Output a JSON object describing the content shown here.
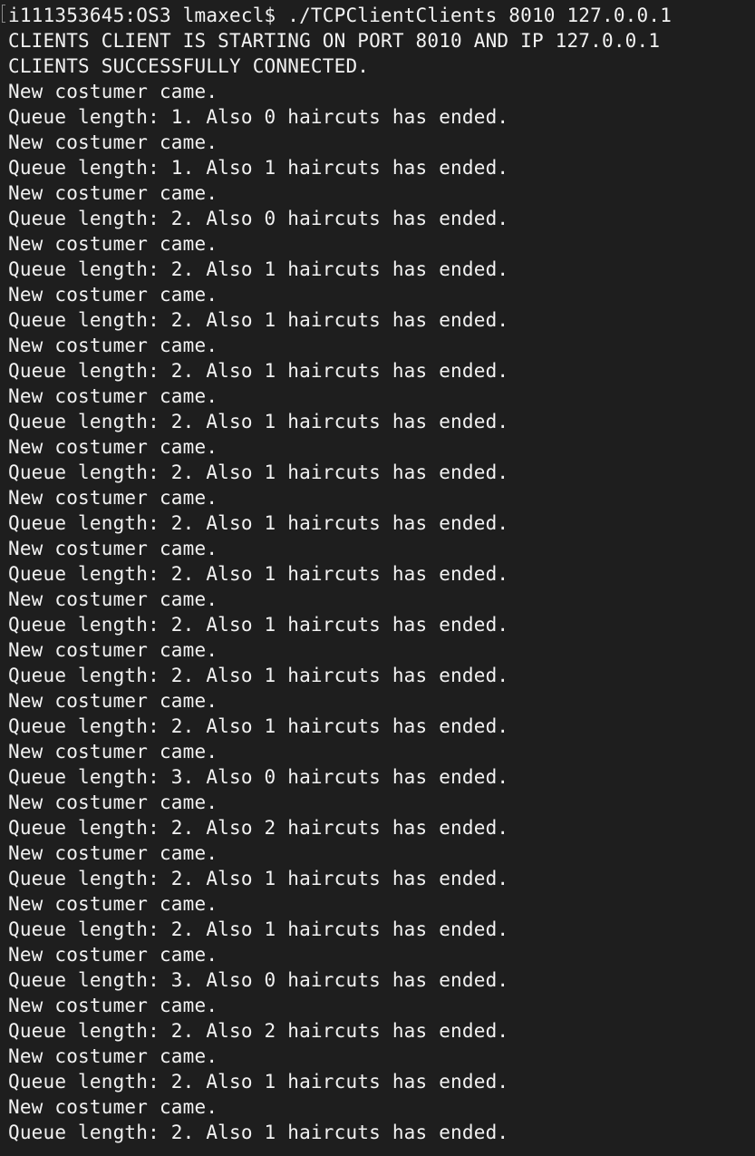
{
  "terminal": {
    "lines": [
      "i111353645:OS3 lmaxecl$ ./TCPClientClients 8010 127.0.0.1",
      "CLIENTS CLIENT IS STARTING ON PORT 8010 AND IP 127.0.0.1",
      "CLIENTS SUCCESSFULLY CONNECTED.",
      "New costumer came.",
      "Queue length: 1. Also 0 haircuts has ended.",
      "New costumer came.",
      "Queue length: 1. Also 1 haircuts has ended.",
      "New costumer came.",
      "Queue length: 2. Also 0 haircuts has ended.",
      "New costumer came.",
      "Queue length: 2. Also 1 haircuts has ended.",
      "New costumer came.",
      "Queue length: 2. Also 1 haircuts has ended.",
      "New costumer came.",
      "Queue length: 2. Also 1 haircuts has ended.",
      "New costumer came.",
      "Queue length: 2. Also 1 haircuts has ended.",
      "New costumer came.",
      "Queue length: 2. Also 1 haircuts has ended.",
      "New costumer came.",
      "Queue length: 2. Also 1 haircuts has ended.",
      "New costumer came.",
      "Queue length: 2. Also 1 haircuts has ended.",
      "New costumer came.",
      "Queue length: 2. Also 1 haircuts has ended.",
      "New costumer came.",
      "Queue length: 2. Also 1 haircuts has ended.",
      "New costumer came.",
      "Queue length: 2. Also 1 haircuts has ended.",
      "New costumer came.",
      "Queue length: 3. Also 0 haircuts has ended.",
      "New costumer came.",
      "Queue length: 2. Also 2 haircuts has ended.",
      "New costumer came.",
      "Queue length: 2. Also 1 haircuts has ended.",
      "New costumer came.",
      "Queue length: 2. Also 1 haircuts has ended.",
      "New costumer came.",
      "Queue length: 3. Also 0 haircuts has ended.",
      "New costumer came.",
      "Queue length: 2. Also 2 haircuts has ended.",
      "New costumer came.",
      "Queue length: 2. Also 1 haircuts has ended.",
      "New costumer came.",
      "Queue length: 2. Also 1 haircuts has ended."
    ]
  }
}
